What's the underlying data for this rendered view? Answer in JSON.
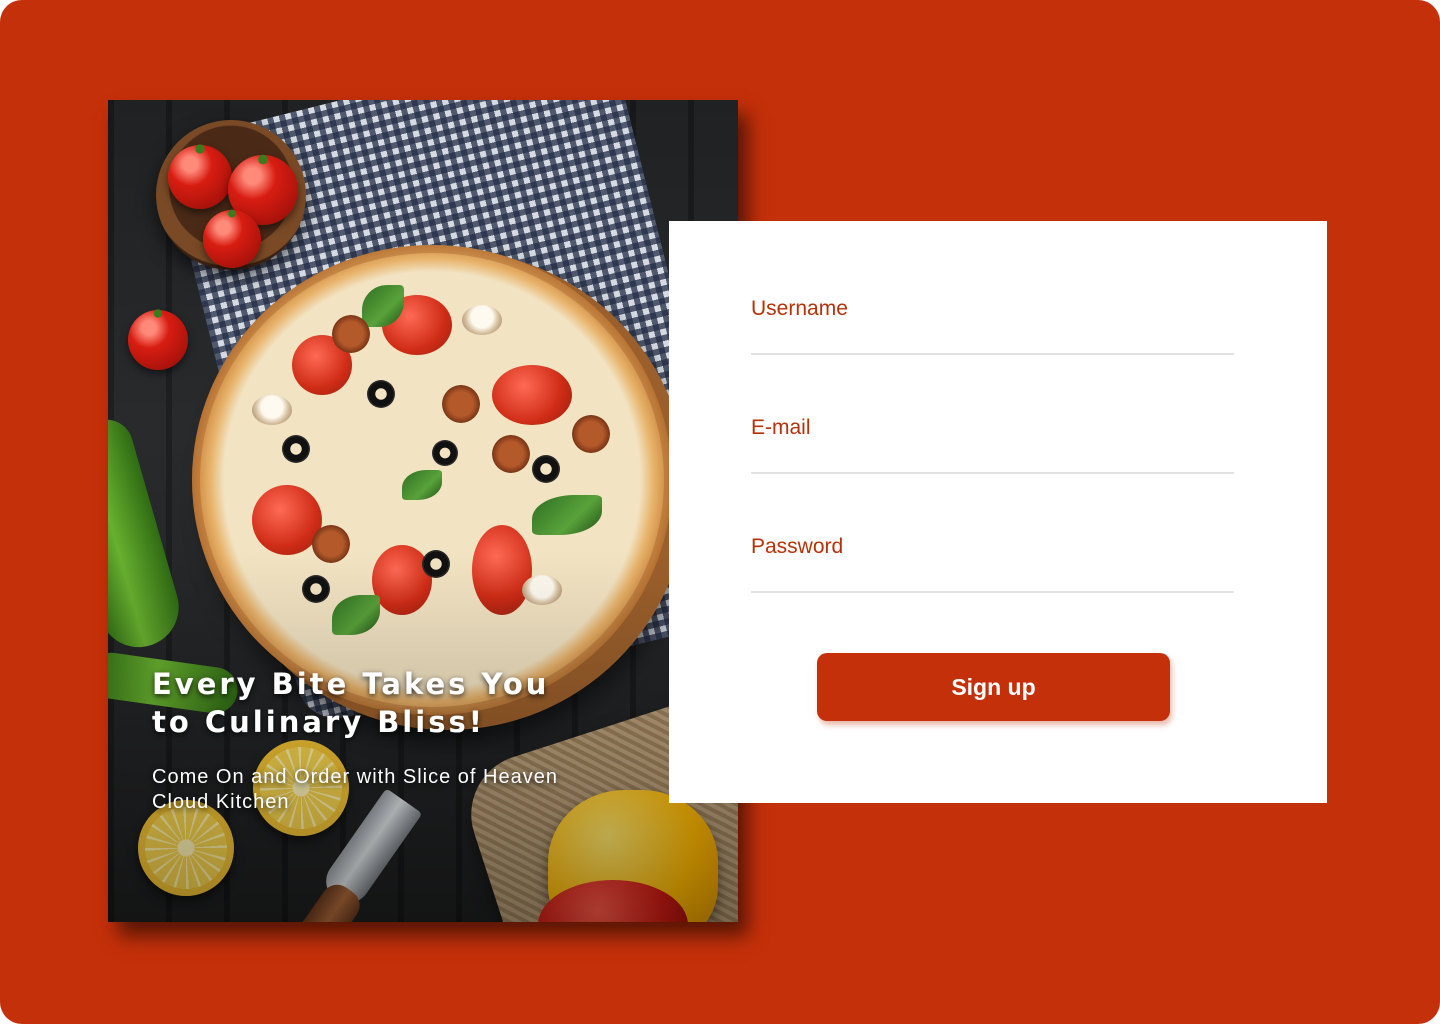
{
  "hero": {
    "title": "Every Bite Takes You\nto Culinary Bliss!",
    "subtitle": "Come On and Order with Slice of Heaven\nCloud Kitchen"
  },
  "form": {
    "username_label": "Username",
    "email_label": "E-mail",
    "password_label": "Password",
    "signup_label": "Sign up"
  },
  "colors": {
    "brand": "#c4300a",
    "label": "#b53208",
    "underline": "#e2e2e2",
    "card": "#ffffff"
  },
  "icons": []
}
